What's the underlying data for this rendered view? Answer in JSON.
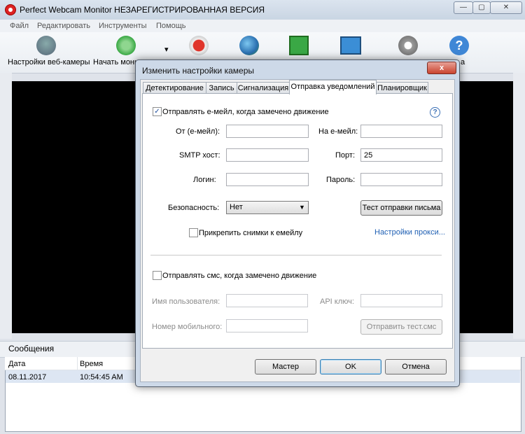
{
  "window": {
    "title": "Perfect Webcam Monitor НЕЗАРЕГИСТРИРОВАННАЯ ВЕРСИЯ",
    "min_glyph": "—",
    "max_glyph": "▢",
    "close_glyph": "✕"
  },
  "menu": [
    "Файл",
    "Редактировать",
    "Инструменты",
    "Помощь"
  ],
  "toolbar": {
    "webcam_settings": "Настройки веб-камеры",
    "start_monitoring": "Начать монито",
    "help_fragment": "а",
    "dropdown_glyph": "▾"
  },
  "messages": {
    "title": "Сообщения",
    "columns": [
      "Дата",
      "Время"
    ],
    "rows": [
      {
        "date": "08.11.2017",
        "time": "10:54:45 AM"
      }
    ]
  },
  "dialog": {
    "title": "Изменить настройки камеры",
    "close_glyph": "x",
    "tabs": [
      "Детектирование",
      "Запись",
      "Сигнализация",
      "Отправка уведомлений",
      "Планировщик"
    ],
    "email": {
      "enabled_label": "Отправлять е-мейл, когда замечено движение",
      "enabled": true,
      "from_label": "От (е-мейл):",
      "from_value": "",
      "to_label": "На е-мейл:",
      "to_value": "",
      "smtp_label": "SMTP хост:",
      "smtp_value": "",
      "port_label": "Порт:",
      "port_value": "25",
      "login_label": "Логин:",
      "login_value": "",
      "password_label": "Пароль:",
      "password_value": "",
      "security_label": "Безопасность:",
      "security_value": "Нет",
      "test_button": "Тест отправки письма",
      "attach_label": "Прикрепить снимки к емейлу",
      "attach_checked": false,
      "proxy_link": "Настройки прокси..."
    },
    "sms": {
      "enabled_label": "Отправлять смс, когда замечено движение",
      "enabled": false,
      "username_label": "Имя пользователя:",
      "api_label": "API ключ:",
      "mobile_label": "Номер мобильного:",
      "test_button": "Отправить тест.смс"
    },
    "buttons": {
      "wizard": "Мастер",
      "ok": "OK",
      "cancel": "Отмена"
    },
    "help_glyph": "?",
    "check_glyph": "✓"
  },
  "colors": {
    "accent_link": "#1e5fb3",
    "record_red": "#e0342a",
    "monitor_green": "#3aa845"
  }
}
